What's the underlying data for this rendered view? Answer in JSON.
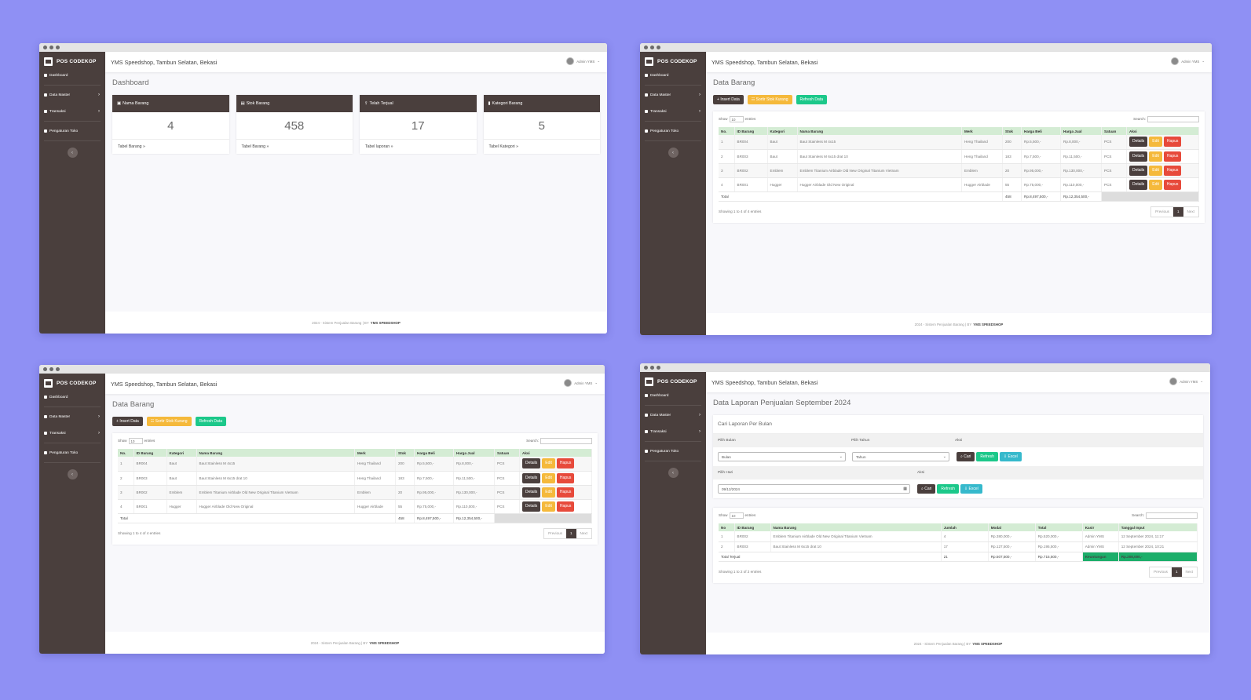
{
  "app": {
    "brand": "POS CODEKOP",
    "store": "YMS Speedshop, Tambun Selatan, Bekasi",
    "user": "Admin YMS",
    "nav": {
      "dashboard": "Dashboard",
      "master": "Data Master",
      "transaksi": "Transaksi",
      "pengaturan": "Pengaturan Toko"
    },
    "footer": {
      "text": "2024 - Sistem Penjualan Barang | BY",
      "brand": "YMS SPEEDSHOP"
    }
  },
  "dashboard": {
    "title": "Dashboard",
    "cards": [
      {
        "label": "Nama Barang",
        "value": "4",
        "link": "Tabel Barang »"
      },
      {
        "label": "Stok Barang",
        "value": "458",
        "link": "Tabel Barang »"
      },
      {
        "label": "Telah Terjual",
        "value": "17",
        "link": "Tabel laporan »"
      },
      {
        "label": "Kategori Barang",
        "value": "5",
        "link": "Tabel Kategori »"
      }
    ]
  },
  "barang": {
    "title": "Data Barang",
    "buttons": {
      "insert": "Insert Data",
      "sortir": "Sortir Stok Kurang",
      "refresh": "Refresh Data"
    },
    "show": "Show",
    "entries_select": "10",
    "entries": "entries",
    "search": "Search:",
    "headers": [
      "No.",
      "ID Barang",
      "Kategori",
      "Nama Barang",
      "Merk",
      "Stok",
      "Harga Beli",
      "Harga Jual",
      "Satuan",
      "Aksi"
    ],
    "rows": [
      [
        "1",
        "BR004",
        "Baut",
        "Baut Stainless M 4x15",
        "Heng Thailand",
        "200",
        "Rp.5,500,-",
        "Rp.8,000,-",
        "PCS"
      ],
      [
        "2",
        "BR003",
        "Baut",
        "Baut Stainless M 6x15 drat 10",
        "Heng Thailand",
        "183",
        "Rp.7,500,-",
        "Rp.11,500,-",
        "PCS"
      ],
      [
        "3",
        "BR002",
        "Emblem",
        "Emblem Titanium Airblade Old New Original Titanium Vietnam",
        "Emblem",
        "20",
        "Rp.95,000,-",
        "Rp.130,000,-",
        "PCS"
      ],
      [
        "4",
        "BR001",
        "Hugger",
        "Hugger Airblade Old New Original",
        "Hugger Airblade",
        "55",
        "Rp.75,000,-",
        "Rp.110,000,-",
        "PCS"
      ]
    ],
    "total": {
      "label": "Total",
      "stok": "458",
      "beli": "Rp.8,497,500,-",
      "jual": "Rp.12,354,500,-"
    },
    "actions": {
      "details": "Details",
      "edit": "Edit",
      "hapus": "Hapus"
    },
    "showing": "Showing 1 to 4 of 4 entries",
    "pager": {
      "prev": "Previous",
      "page": "1",
      "next": "Next"
    }
  },
  "laporan": {
    "title": "Data Laporan Penjualan September 2024",
    "filter_title": "Cari Laporan Per Bulan",
    "labels": {
      "bulan": "Pilih Bulan",
      "tahun": "Pilih Tahun",
      "aksi": "Aksi",
      "hari": "Pilih Hari"
    },
    "bulan_value": "Bulan",
    "tahun_value": "Tahun",
    "date_value": "09/12/2024",
    "buttons": {
      "cari": "Cari",
      "refresh": "Refresh",
      "excel": "Excel"
    },
    "show": "Show",
    "entries_select": "10",
    "entries": "entries",
    "search": "Search:",
    "headers": [
      "No",
      "ID Barang",
      "Nama Barang",
      "Jumlah",
      "Modal",
      "Total",
      "Kasir",
      "Tanggal Input"
    ],
    "rows": [
      [
        "1",
        "BR002",
        "Emblem Titanium Airblade Old New Original Titanium Vietnam",
        "4",
        "Rp.380,000,-",
        "Rp.520,000,-",
        "Admin YMS",
        "12 September 2024, 11:17"
      ],
      [
        "2",
        "BR003",
        "Baut Stainless M 6x15 drat 10",
        "17",
        "Rp.127,500,-",
        "Rp.195,500,-",
        "Admin YMS",
        "12 September 2024, 10:21"
      ]
    ],
    "total": {
      "label": "Total Terjual",
      "jumlah": "21",
      "modal": "Rp.507,500,-",
      "total": "Rp.715,500,-",
      "keuntungan_label": "Keuntungan",
      "keuntungan": "Rp.208,000,-"
    },
    "showing": "Showing 1 to 2 of 2 entries",
    "pager": {
      "prev": "Previous",
      "page": "1",
      "next": "Next"
    }
  },
  "colors": {
    "background": "#8f90f4",
    "sidebar": "#4a3f3d",
    "header_green": "#d4ecd4",
    "success": "#1cc88a",
    "warning": "#f5b93b",
    "danger": "#e74a3b",
    "info": "#36b9cc"
  }
}
